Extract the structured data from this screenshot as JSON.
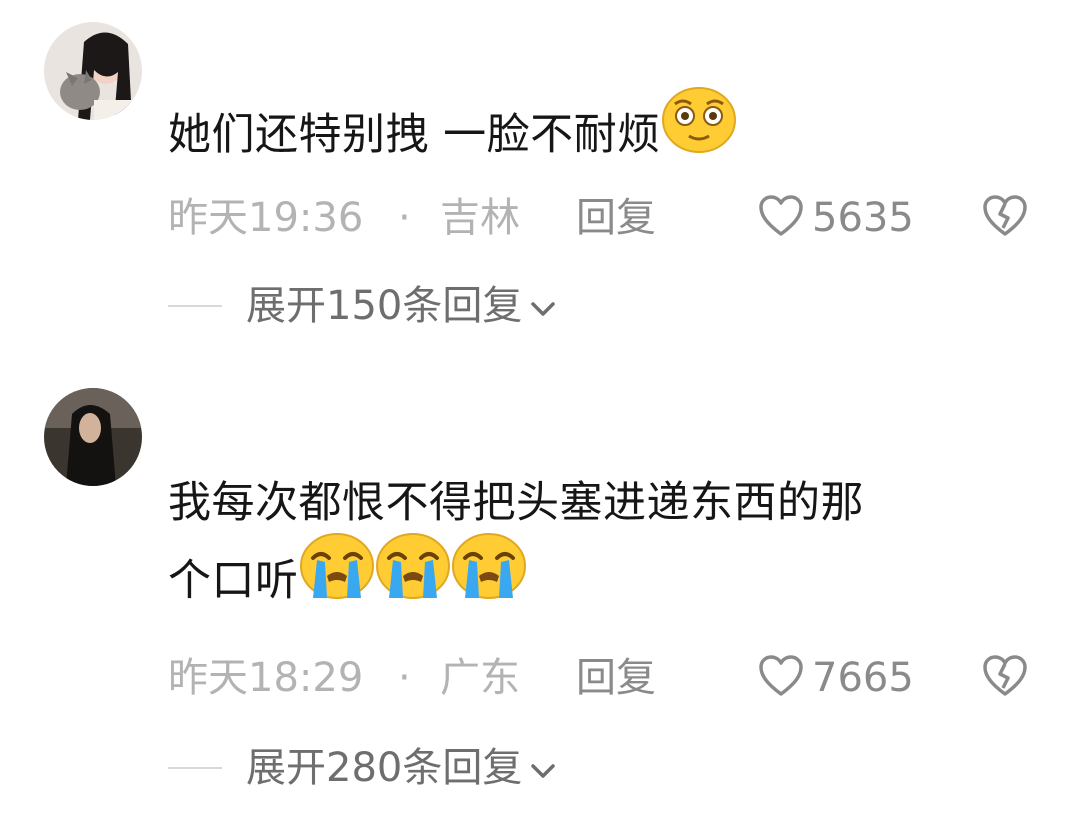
{
  "comments": [
    {
      "text": "她们还特别拽 一脸不耐烦",
      "emoji": [
        "flushed-face"
      ],
      "time": "昨天19:36",
      "separator": "·",
      "location": "吉林",
      "reply_label": "回复",
      "likes": "5635",
      "expand_label": "展开150条回复"
    },
    {
      "text_line1": "我每次都恨不得把头塞进递东西的那",
      "text_line2": "个口听",
      "emoji": [
        "loudly-crying-face",
        "loudly-crying-face",
        "loudly-crying-face"
      ],
      "time": "昨天18:29",
      "separator": "·",
      "location": "广东",
      "reply_label": "回复",
      "likes": "7665",
      "expand_label": "展开280条回复"
    }
  ],
  "colors": {
    "text_primary": "#161616",
    "text_meta": "#b3b3b3",
    "text_secondary": "#8a8a8a",
    "emoji_yellow": "#ffcc33",
    "tear_blue": "#3aa8f0"
  }
}
